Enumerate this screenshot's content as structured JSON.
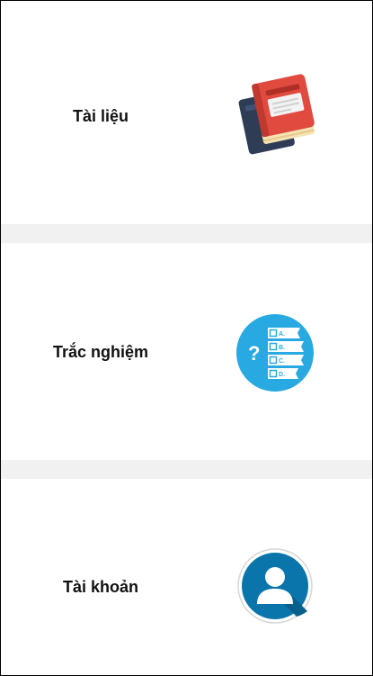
{
  "menu": {
    "items": [
      {
        "label": "Tài liệu",
        "icon": "books-icon"
      },
      {
        "label": "Trắc nghiệm",
        "icon": "quiz-icon"
      },
      {
        "label": "Tài khoản",
        "icon": "account-icon"
      }
    ]
  },
  "colors": {
    "background": "#ffffff",
    "separator": "#f1f1f1",
    "book_dark": "#2e3c56",
    "book_red": "#e04a3f",
    "quiz_blue": "#29a9e1",
    "account_blue": "#0a75aa"
  }
}
